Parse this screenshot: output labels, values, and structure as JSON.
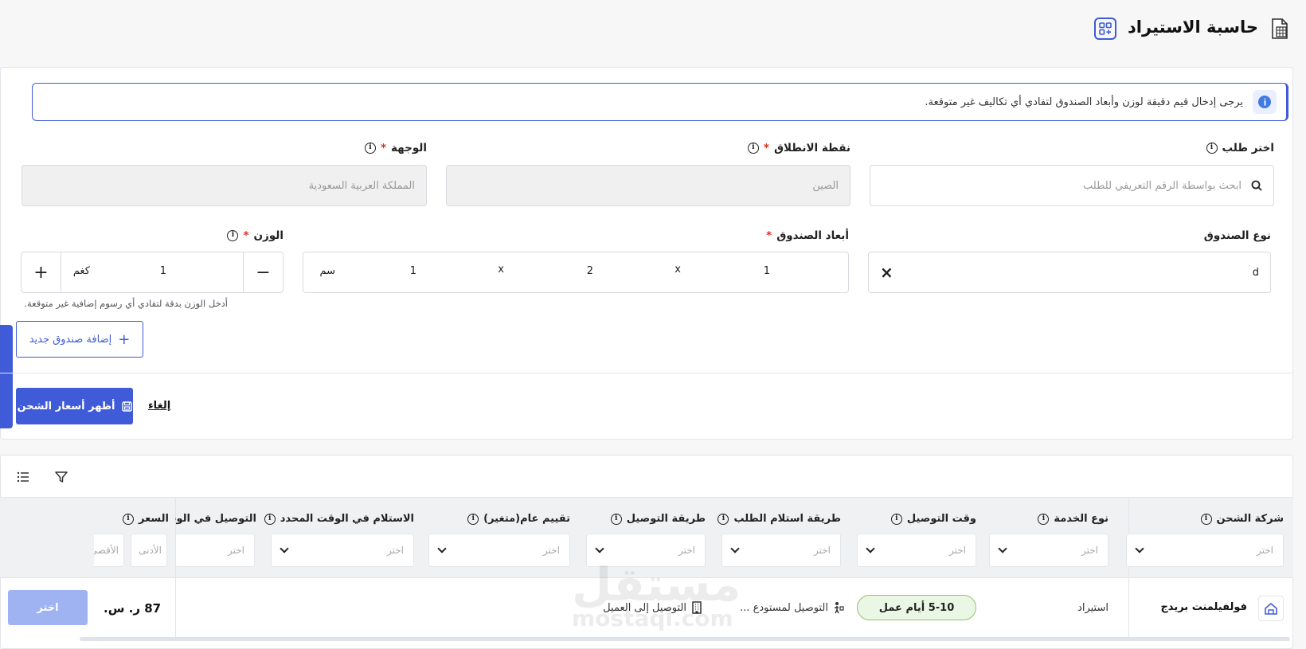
{
  "header": {
    "title": "حاسبة الاستيراد",
    "doc_icon": "spreadsheet-icon",
    "grid_icon": "grid-add-icon"
  },
  "notice": {
    "text": "يرجى إدخال قيم دقيقة لوزن وأبعاد الصندوق لتفادي أي تكاليف غير متوقعة."
  },
  "form": {
    "order": {
      "label": "اختر طلب",
      "placeholder": "ابحث بواسطة الرقم التعريفي للطلب"
    },
    "origin": {
      "label": "نقطة الانطلاق",
      "required": "*",
      "value": "الصين"
    },
    "destination": {
      "label": "الوجهة",
      "required": "*",
      "value": "المملكة العربية السعودية"
    },
    "box_type": {
      "label": "نوع الصندوق",
      "value": "d",
      "clear": "×"
    },
    "dimensions": {
      "label": "أبعاد الصندوق",
      "required": "*",
      "length": "1",
      "width": "2",
      "height": "1",
      "sep": "x",
      "unit": "سم"
    },
    "weight": {
      "label": "الوزن",
      "required": "*",
      "value": "1",
      "unit": "كغم",
      "minus": "−",
      "plus": "+",
      "hint": "أدخل الوزن بدقة لتفادي أي رسوم إضافية غير متوقعة."
    },
    "add_box": "إضافة صندوق جديد",
    "show_rates": "أظهر أسعار الشحن",
    "cancel": "إلغاء"
  },
  "table": {
    "columns": [
      {
        "label": "شركة الشحن",
        "placeholder": "اختر"
      },
      {
        "label": "نوع الخدمة",
        "placeholder": "اختر"
      },
      {
        "label": "وقت التوصيل",
        "placeholder": "اختر"
      },
      {
        "label": "طريقة استلام الطلب",
        "placeholder": "اختر"
      },
      {
        "label": "طريقة التوصيل",
        "placeholder": "اختر"
      },
      {
        "label": "تقييم عام(متغير)",
        "placeholder": "اختر"
      },
      {
        "label": "الاستلام في الوقت المحدد",
        "placeholder": "اختر"
      },
      {
        "label": "التوصيل في الوقت",
        "placeholder": "اختر"
      },
      {
        "label": "السعر",
        "min_placeholder": "الأدنى",
        "max_placeholder": "الأقصى"
      }
    ],
    "rows": [
      {
        "carrier": "فولفيلمنت بريدج",
        "service": "استيراد",
        "time": "5-10 أيام عمل",
        "pickup": "التوصيل لمستودع ...",
        "delivery": "التوصيل إلى العميل",
        "price": "87 ر. س.",
        "select": "اختر"
      }
    ]
  },
  "watermark": {
    "ar": "مستقل",
    "en": "mostaql.com"
  },
  "colors": {
    "primary": "#3f5bd8",
    "badge_bg": "#eaf7e4",
    "badge_border": "#8ac46a"
  }
}
